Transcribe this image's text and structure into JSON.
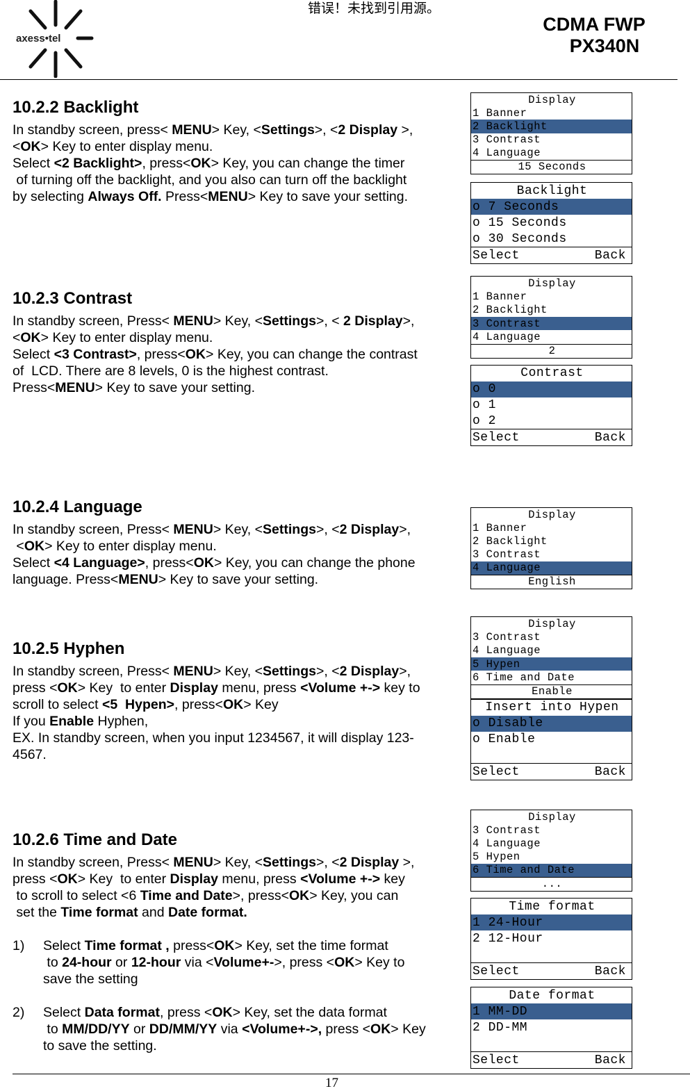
{
  "header": {
    "logo_text": "axess•tel",
    "error_text": "错误！未找到引用源。",
    "model_line1": "CDMA FWP",
    "model_line2": "PX340N"
  },
  "footer": {
    "page_number": "17"
  },
  "colors": {
    "highlight": "#3a5f8f"
  },
  "sections": [
    {
      "heading": "10.2.2 Backlight",
      "lines": [
        [
          [
            "In standby screen, press< ",
            0
          ],
          [
            "MENU",
            1
          ],
          [
            "> Key, <",
            0
          ],
          [
            "Settings",
            1
          ],
          [
            ">, <",
            0
          ],
          [
            "2 Display",
            1
          ],
          [
            " >,",
            0
          ]
        ],
        [
          [
            "<",
            0
          ],
          [
            "OK",
            1
          ],
          [
            "> Key to enter display menu.",
            0
          ]
        ],
        [
          [
            "Select ",
            0
          ],
          [
            "<2 Backlight>",
            1
          ],
          [
            ", press<",
            0
          ],
          [
            "OK",
            1
          ],
          [
            "> Key, you can change the timer",
            0
          ]
        ],
        [
          [
            " of turning off the backlight, and you also can turn off the backlight",
            0
          ]
        ],
        [
          [
            "by selecting ",
            0
          ],
          [
            "Always Off.",
            1
          ],
          [
            " Press<",
            0
          ],
          [
            "MENU",
            1
          ],
          [
            "> Key to save your setting.",
            0
          ]
        ]
      ]
    },
    {
      "heading": "10.2.3 Contrast",
      "lines": [
        [
          [
            "In standby screen, Press< ",
            0
          ],
          [
            "MENU",
            1
          ],
          [
            "> Key, <",
            0
          ],
          [
            "Settings",
            1
          ],
          [
            ">, < ",
            0
          ],
          [
            "2 Display",
            1
          ],
          [
            ">,",
            0
          ]
        ],
        [
          [
            "<",
            0
          ],
          [
            "OK",
            1
          ],
          [
            "> Key to enter display menu.",
            0
          ]
        ],
        [
          [
            "Select ",
            0
          ],
          [
            "<3 Contrast>",
            1
          ],
          [
            ", press<",
            0
          ],
          [
            "OK",
            1
          ],
          [
            "> Key, you can change the contrast",
            0
          ]
        ],
        [
          [
            "of  LCD. There are 8 levels, 0 is the highest contrast.",
            0
          ]
        ],
        [
          [
            "Press<",
            0
          ],
          [
            "MENU",
            1
          ],
          [
            "> Key to save your setting.",
            0
          ]
        ]
      ]
    },
    {
      "heading": "10.2.4 Language",
      "lines": [
        [
          [
            "In standby screen, Press< ",
            0
          ],
          [
            "MENU",
            1
          ],
          [
            "> Key, <",
            0
          ],
          [
            "Settings",
            1
          ],
          [
            ">, <",
            0
          ],
          [
            "2 Display",
            1
          ],
          [
            ">,",
            0
          ]
        ],
        [
          [
            " <",
            0
          ],
          [
            "OK",
            1
          ],
          [
            "> Key to enter display menu.",
            0
          ]
        ],
        [
          [
            "Select ",
            0
          ],
          [
            "<4 Language>",
            1
          ],
          [
            ", press<",
            0
          ],
          [
            "OK",
            1
          ],
          [
            "> Key, you can change the phone",
            0
          ]
        ],
        [
          [
            "language. Press<",
            0
          ],
          [
            "MENU",
            1
          ],
          [
            "> Key to save your setting.",
            0
          ]
        ]
      ]
    },
    {
      "heading": "10.2.5 Hyphen",
      "lines": [
        [
          [
            "In standby screen, Press< ",
            0
          ],
          [
            "MENU",
            1
          ],
          [
            "> Key, <",
            0
          ],
          [
            "Settings",
            1
          ],
          [
            ">, <",
            0
          ],
          [
            "2 Display",
            1
          ],
          [
            ">,",
            0
          ]
        ],
        [
          [
            "press <",
            0
          ],
          [
            "OK",
            1
          ],
          [
            "> Key  to enter ",
            0
          ],
          [
            "Display",
            1
          ],
          [
            " menu, press ",
            0
          ],
          [
            "<Volume +->",
            1
          ],
          [
            " key to",
            0
          ]
        ],
        [
          [
            "scroll to select ",
            0
          ],
          [
            "<5  Hypen>",
            1
          ],
          [
            ", press<",
            0
          ],
          [
            "OK",
            1
          ],
          [
            "> Key",
            0
          ]
        ],
        [
          [
            "If you ",
            0
          ],
          [
            "Enable",
            1
          ],
          [
            " Hyphen,",
            0
          ]
        ],
        [
          [
            "EX. In standby screen, when you input 1234567, it will display 123-",
            0
          ]
        ],
        [
          [
            "4567.",
            0
          ]
        ]
      ]
    },
    {
      "heading": "10.2.6 Time and Date",
      "lines": [
        [
          [
            "In standby screen, Press< ",
            0
          ],
          [
            "MENU",
            1
          ],
          [
            "> Key, <",
            0
          ],
          [
            "Settings",
            1
          ],
          [
            ">, <",
            0
          ],
          [
            "2 Display",
            1
          ],
          [
            " >,",
            0
          ]
        ],
        [
          [
            "press <",
            0
          ],
          [
            "OK",
            1
          ],
          [
            "> Key  to enter ",
            0
          ],
          [
            "Display",
            1
          ],
          [
            " menu, press ",
            0
          ],
          [
            "<Volume +->",
            1
          ],
          [
            " key",
            0
          ]
        ],
        [
          [
            " to scroll to select <6 ",
            0
          ],
          [
            "Time and Date",
            1
          ],
          [
            ">, press<",
            0
          ],
          [
            "OK",
            1
          ],
          [
            "> Key, you can",
            0
          ]
        ],
        [
          [
            " set the ",
            0
          ],
          [
            "Time format",
            1
          ],
          [
            " and ",
            0
          ],
          [
            "Date format.",
            1
          ]
        ]
      ],
      "list": [
        {
          "num": "1)",
          "lines": [
            [
              [
                "Select ",
                0
              ],
              [
                "Time format ,",
                1
              ],
              [
                " press<",
                0
              ],
              [
                "OK",
                1
              ],
              [
                "> Key, set the time format",
                0
              ]
            ],
            [
              [
                " to ",
                0
              ],
              [
                "24-hour",
                1
              ],
              [
                " or ",
                0
              ],
              [
                "12-hour",
                1
              ],
              [
                " via <",
                0
              ],
              [
                "Volume+-",
                1
              ],
              [
                ">, press <",
                0
              ],
              [
                "OK",
                1
              ],
              [
                "> Key to",
                0
              ]
            ],
            [
              [
                "save the setting",
                0
              ]
            ]
          ]
        },
        {
          "num": "2)",
          "lines": [
            [
              [
                "Select ",
                0
              ],
              [
                "Data format",
                1
              ],
              [
                ", press <",
                0
              ],
              [
                "OK",
                1
              ],
              [
                "> Key, set the data format",
                0
              ]
            ],
            [
              [
                " to ",
                0
              ],
              [
                "MM/DD/YY",
                1
              ],
              [
                " or ",
                0
              ],
              [
                "DD/MM/YY",
                1
              ],
              [
                " via ",
                0
              ],
              [
                "<Volume+->,",
                1
              ],
              [
                " press <",
                0
              ],
              [
                "OK",
                1
              ],
              [
                "> Key",
                0
              ]
            ],
            [
              [
                "to save the setting.",
                0
              ]
            ]
          ]
        }
      ]
    }
  ],
  "screens": [
    {
      "title": "Display",
      "items": [
        "1 Banner",
        "2 Backlight",
        "3 Contrast",
        "4 Language"
      ],
      "selected": 1,
      "footer": "15 Seconds"
    },
    {
      "title": "Backlight",
      "items": [
        "o 7 Seconds",
        "o 15 Seconds",
        "o 30 Seconds"
      ],
      "selected": 0,
      "footer_left": "Select",
      "footer_right": "Back"
    },
    {
      "title": "Display",
      "items": [
        "1 Banner",
        "2 Backlight",
        "3 Contrast",
        "4 Language"
      ],
      "selected": 2,
      "footer": "2"
    },
    {
      "title": "Contrast",
      "items": [
        "o 0",
        "o 1",
        "o 2"
      ],
      "selected": 0,
      "footer_left": "Select",
      "footer_right": "Back"
    },
    {
      "title": "Display",
      "items": [
        "1 Banner",
        "2 Backlight",
        "3 Contrast",
        "4 Language"
      ],
      "selected": 3,
      "footer": "English"
    },
    {
      "title": "Display",
      "items": [
        "3 Contrast",
        "4 Language",
        "5 Hypen",
        "6 Time and Date"
      ],
      "selected": 2,
      "footer": "Enable"
    },
    {
      "title": "Insert into Hypen",
      "items": [
        "o Disable",
        "o Enable",
        ""
      ],
      "selected": 0,
      "footer_left": "Select",
      "footer_right": "Back"
    },
    {
      "title": "Display",
      "items": [
        "3 Contrast",
        "4 Language",
        "5 Hypen",
        "6 Time and Date"
      ],
      "selected": 3,
      "footer": "..."
    },
    {
      "title": "Time format",
      "items": [
        "1 24-Hour",
        "2 12-Hour",
        ""
      ],
      "selected": 0,
      "footer_left": "Select",
      "footer_right": "Back"
    },
    {
      "title": "Date format",
      "items": [
        "1 MM-DD",
        "2 DD-MM",
        ""
      ],
      "selected": 0,
      "footer_left": "Select",
      "footer_right": "Back"
    }
  ]
}
